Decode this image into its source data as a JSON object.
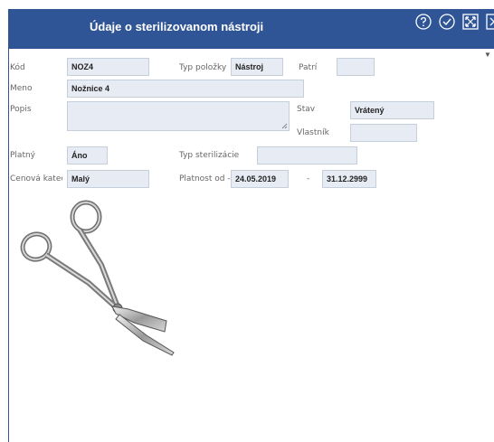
{
  "title": "Údaje o sterilizovanom nástroji",
  "toolbar": {
    "icons": [
      "help-icon",
      "check-icon",
      "fullscreen-icon",
      "close-icon"
    ]
  },
  "fields": {
    "kod": {
      "label": "Kód",
      "value": "NOZ4"
    },
    "typ_polozky": {
      "label": "Typ položky",
      "value": "Nástroj"
    },
    "patri": {
      "label": "Patrí",
      "value": ""
    },
    "meno": {
      "label": "Meno",
      "value": "Nožnice 4"
    },
    "popis": {
      "label": "Popis",
      "value": ""
    },
    "stav": {
      "label": "Stav",
      "value": "Vrátený"
    },
    "vlastnik": {
      "label": "Vlastník",
      "value": ""
    },
    "platny": {
      "label": "Platný",
      "value": "Áno"
    },
    "typ_sterilizacie": {
      "label": "Typ sterilizácie",
      "value": ""
    },
    "cenova_kategoria": {
      "label": "Cenová kateç",
      "value": "Malý"
    },
    "platnost": {
      "label": "Platnost od -",
      "from": "24.05.2019",
      "separator": "-",
      "to": "31.12.2999"
    }
  }
}
